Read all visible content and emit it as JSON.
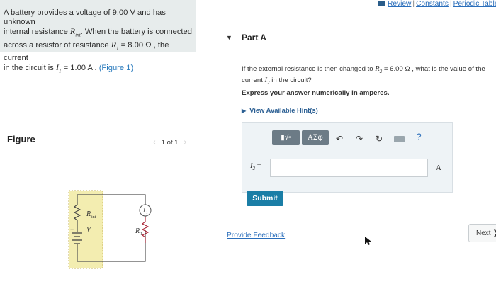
{
  "problem": {
    "line1": "A battery provides a voltage of 9.00 V and has unknown",
    "line2a": "internal resistance ",
    "line2_var": "R",
    "line2_sub": "int",
    "line2b": ". When the battery is connected",
    "line3a": "across a resistor of resistance ",
    "line3_var": "R",
    "line3_sub": "1",
    "line3b": " = 8.00 Ω , the current",
    "line4a": "in the circuit is ",
    "line4_var": "I",
    "line4_sub": "1",
    "line4b": " = 1.00 A . ",
    "figure_link": "(Figure 1)"
  },
  "figure": {
    "label": "Figure",
    "counter": "1 of 1",
    "prev": "‹",
    "next": "›",
    "diagram_labels": {
      "r_int": "R",
      "r_int_sub": "int",
      "voltage": "V",
      "r1": "R",
      "r1_sub": "1",
      "i1": "I",
      "i1_sub": "1"
    }
  },
  "top_links": {
    "review": "Review",
    "constants": "Constants",
    "periodic": "Periodic Table",
    "separator": "|"
  },
  "part": {
    "title": "Part A",
    "toggle": "▼"
  },
  "question": {
    "text_a": "If the external resistance is then changed to ",
    "var_a": "R",
    "sub_a": "2",
    "text_b": " = 6.00 Ω , what is the value of the",
    "text_c": "current ",
    "var_b": "I",
    "sub_b": "2",
    "text_d": " in the circuit?"
  },
  "instruction": "Express your answer numerically in amperes.",
  "hints": {
    "label": "View Available Hint(s)",
    "icon": "▶"
  },
  "toolbar": {
    "template": "▮√▫",
    "greek": "ΑΣφ",
    "undo": "↶",
    "redo": "↷",
    "reset": "↻",
    "help": "?"
  },
  "answer": {
    "label_var": "I",
    "label_sub": "2",
    "label_eq": " =",
    "value": "",
    "placeholder": "",
    "unit": "A"
  },
  "submit_label": "Submit",
  "feedback_label": "Provide Feedback",
  "next_label": "Next ❯",
  "colors": {
    "accent": "#1a7ea6",
    "link": "#2a6ebb",
    "problem_bg": "#e7ecec",
    "answer_bg": "#eef3f6"
  }
}
